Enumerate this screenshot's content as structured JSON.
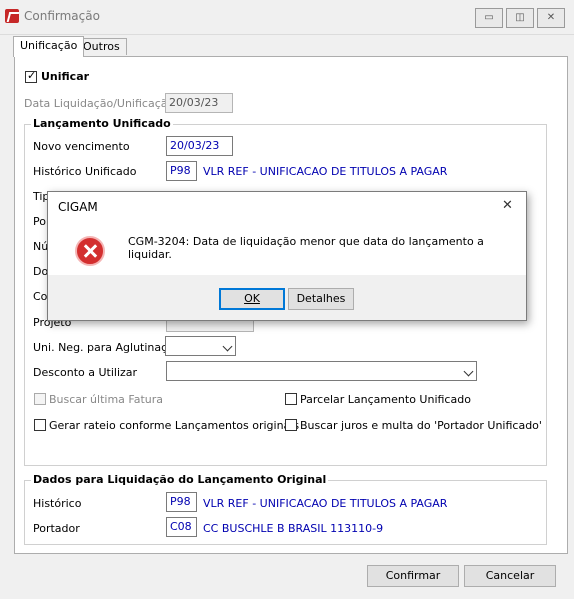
{
  "window": {
    "title": "Confirmação",
    "minimize": "▭",
    "restore": "◫",
    "close": "✕"
  },
  "tabs": [
    {
      "label": "Unificação"
    },
    {
      "label": "Outros"
    }
  ],
  "unificar": {
    "label": "Unificar",
    "checked": true
  },
  "data_liquidacao": {
    "label": "Data Liquidação/Unificação",
    "value": "20/03/23"
  },
  "lancamento": {
    "title": "Lançamento Unificado",
    "novo_vencimento": {
      "label": "Novo vencimento",
      "value": "20/03/23"
    },
    "historico": {
      "label": "Histórico Unificado",
      "code": "P98",
      "desc": "VLR REF - UNIFICACAO DE TITULOS A PAGAR"
    },
    "partial_labels": [
      "Tipo de Documento",
      "Por",
      "Núm",
      "Doc",
      "Con"
    ],
    "projeto": {
      "label": "Projeto"
    },
    "uni_neg": {
      "label": "Uni. Neg. para Aglutinação"
    },
    "desconto": {
      "label": "Desconto a Utilizar"
    },
    "buscar_fatura": {
      "label": "Buscar última Fatura"
    },
    "parcelar": {
      "label": "Parcelar Lançamento Unificado"
    },
    "gerar_rateio": {
      "label": "Gerar rateio conforme Lançamentos originais"
    },
    "buscar_juros": {
      "label": "Buscar juros e multa do 'Portador Unificado'"
    }
  },
  "dados": {
    "title": "Dados para Liquidação do Lançamento Original",
    "historico": {
      "label": "Histórico",
      "code": "P98",
      "desc": "VLR REF - UNIFICACAO DE TITULOS A PAGAR"
    },
    "portador": {
      "label": "Portador",
      "code": "C08",
      "desc": "CC BUSCHLE B BRASIL 113110-9"
    }
  },
  "buttons": {
    "confirmar": "Confirmar",
    "cancelar": "Cancelar"
  },
  "dialog": {
    "title": "CIGAM",
    "close": "✕",
    "icon": "error-icon",
    "message": "CGM-3204: Data de liquidação menor que data do lançamento a liquidar.",
    "ok": "OK",
    "details": "Detalhes"
  },
  "colors": {
    "link_blue": "#0000b0",
    "error_red": "#d32f2f"
  }
}
